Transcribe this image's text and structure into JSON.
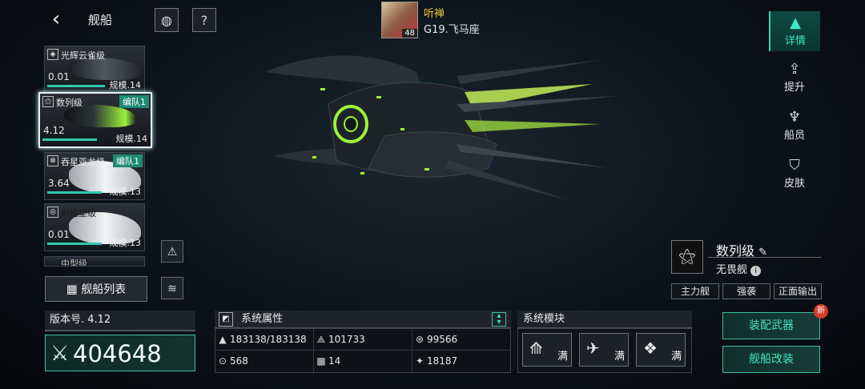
{
  "header": {
    "back_icon": "‹",
    "title": "舰船"
  },
  "player": {
    "name": "听禅",
    "level": "48",
    "location": "G19.飞马座"
  },
  "right_tabs": [
    {
      "label": "详情",
      "icon": "details-icon"
    },
    {
      "label": "提升",
      "icon": "upgrade-icon"
    },
    {
      "label": "船员",
      "icon": "crew-icon"
    },
    {
      "label": "皮肤",
      "icon": "skin-icon"
    }
  ],
  "ship_list": [
    {
      "name": "光辉云雀级",
      "rate": "0.01",
      "scale": "规模.14",
      "badge": "",
      "bar_fraction": 0.6
    },
    {
      "name": "数列级",
      "rate": "4.12",
      "scale": "规模.14",
      "badge": "编队1",
      "bar_fraction": 0.5
    },
    {
      "name": "吞星亚龙级",
      "rate": "3.64",
      "scale": "规模.13",
      "badge": "编队1",
      "bar_fraction": 0.55
    },
    {
      "name": "刺锤堡级",
      "rate": "0.01",
      "scale": "规模.13",
      "badge": "",
      "bar_fraction": 0.55
    },
    {
      "name": "中型级",
      "rate": "",
      "scale": "",
      "badge": "",
      "bar_fraction": 0
    }
  ],
  "ship_list_button": "舰船列表",
  "ship_info": {
    "name": "数列级",
    "type": "无畏舰",
    "tags": [
      "主力舰",
      "强袭",
      "正面输出"
    ]
  },
  "version": "版本号. 4.12",
  "power": "404648",
  "attributes": {
    "title": "系统属性",
    "items": [
      {
        "icon": "hp-icon",
        "value": "183138/183138"
      },
      {
        "icon": "armor-icon",
        "value": "101733"
      },
      {
        "icon": "shield-icon",
        "value": "99566"
      },
      {
        "icon": "speed-icon",
        "value": "568"
      },
      {
        "icon": "grid-icon",
        "value": "14"
      },
      {
        "icon": "target-icon",
        "value": "18187"
      }
    ]
  },
  "modules": {
    "title": "系统模块",
    "items": [
      {
        "label": "满"
      },
      {
        "label": "满"
      },
      {
        "label": "满"
      }
    ]
  },
  "actions": {
    "weapons": "装配武器",
    "modify": "舰船改装",
    "new_badge": "新"
  }
}
